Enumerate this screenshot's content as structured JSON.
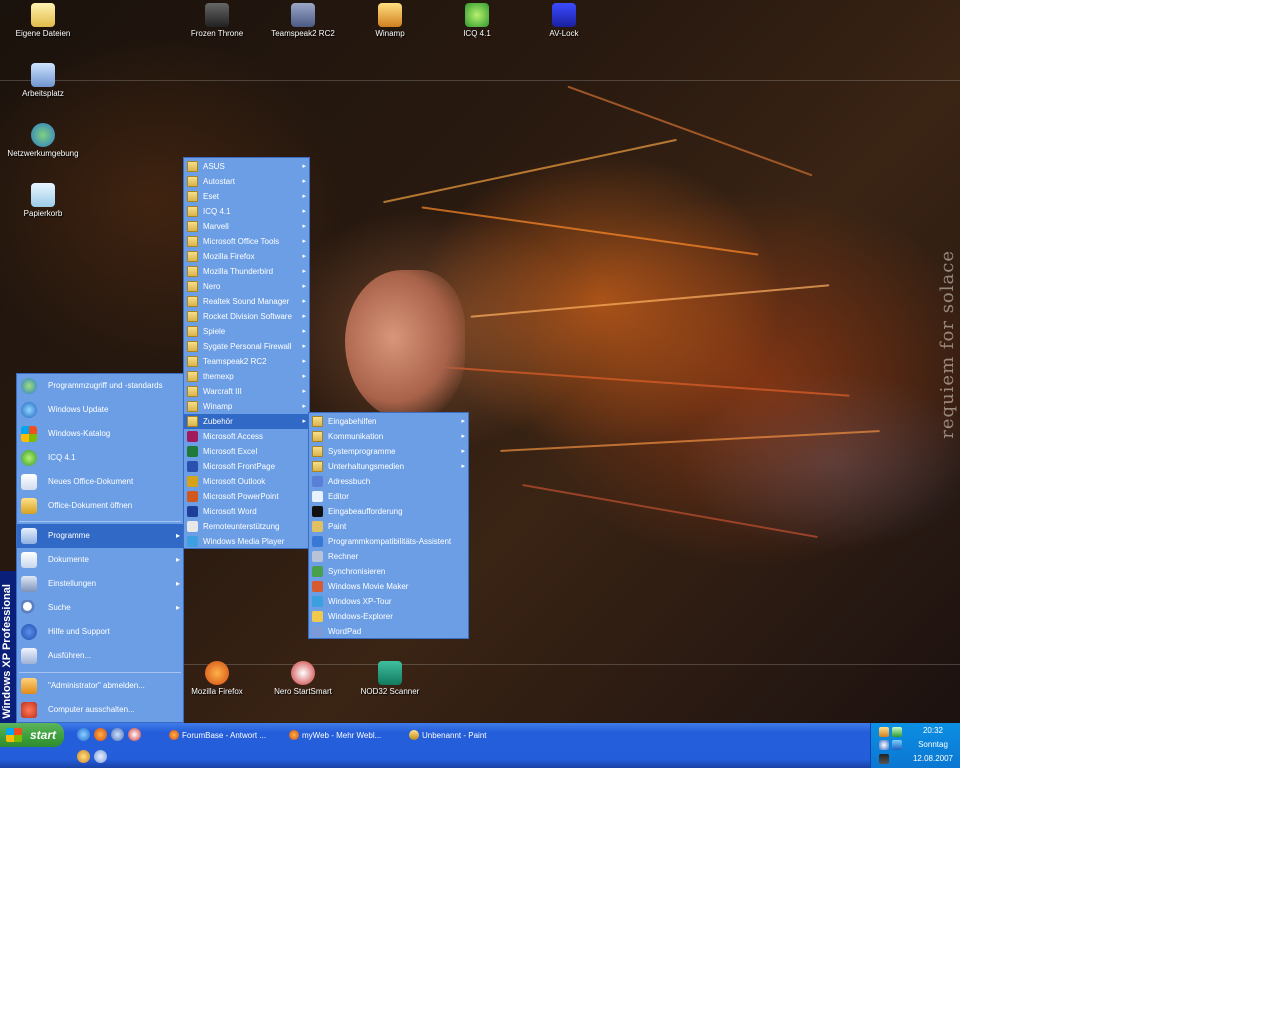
{
  "desktop": {
    "icons_left": [
      {
        "label": "Eigene Dateien",
        "icon": "documents-folder-icon"
      },
      {
        "label": "Arbeitsplatz",
        "icon": "my-computer-icon"
      },
      {
        "label": "Netzwerkumgebung",
        "icon": "network-places-icon"
      },
      {
        "label": "Papierkorb",
        "icon": "recycle-bin-icon"
      }
    ],
    "icons_top": [
      {
        "label": "Frozen Throne",
        "icon": "warcraft-icon"
      },
      {
        "label": "Teamspeak2 RC2",
        "icon": "teamspeak-icon"
      },
      {
        "label": "Winamp",
        "icon": "winamp-icon"
      },
      {
        "label": "ICQ 4.1",
        "icon": "icq-icon"
      },
      {
        "label": "AV-Lock",
        "icon": "av-lock-icon"
      }
    ],
    "icons_bottom": [
      {
        "label": "Mozilla Firefox",
        "icon": "firefox-icon"
      },
      {
        "label": "Nero StartSmart",
        "icon": "nero-icon"
      },
      {
        "label": "NOD32 Scanner",
        "icon": "nod32-icon"
      }
    ],
    "wallpaper_text": "requiem for solace"
  },
  "start_menu": {
    "band_text": "Windows XP Professional",
    "top_items": [
      {
        "label": "Programmzugriff und -standards",
        "icon": "program-defaults-icon"
      },
      {
        "label": "Windows Update",
        "icon": "windows-update-icon"
      },
      {
        "label": "Windows-Katalog",
        "icon": "windows-catalog-icon"
      },
      {
        "label": "ICQ 4.1",
        "icon": "icq-icon"
      },
      {
        "label": "Neues Office-Dokument",
        "icon": "new-office-doc-icon"
      },
      {
        "label": "Office-Dokument öffnen",
        "icon": "open-office-doc-icon"
      }
    ],
    "main_items": [
      {
        "label": "Programme",
        "icon": "programs-icon",
        "arrow": "▸",
        "highlight": true
      },
      {
        "label": "Dokumente",
        "icon": "documents-icon",
        "arrow": "▸"
      },
      {
        "label": "Einstellungen",
        "icon": "settings-icon",
        "arrow": "▸"
      },
      {
        "label": "Suche",
        "icon": "search-icon",
        "arrow": "▸"
      },
      {
        "label": "Hilfe und Support",
        "icon": "help-icon",
        "arrow": ""
      },
      {
        "label": "Ausführen...",
        "icon": "run-icon",
        "arrow": ""
      }
    ],
    "bottom_items": [
      {
        "label": "\"Administrator\" abmelden...",
        "icon": "logoff-icon"
      },
      {
        "label": "Computer ausschalten...",
        "icon": "shutdown-icon"
      }
    ]
  },
  "programs_menu": [
    {
      "label": "ASUS",
      "folder": true
    },
    {
      "label": "Autostart",
      "folder": true
    },
    {
      "label": "Eset",
      "folder": true
    },
    {
      "label": "ICQ 4.1",
      "folder": true
    },
    {
      "label": "Marvell",
      "folder": true
    },
    {
      "label": "Microsoft Office Tools",
      "folder": true
    },
    {
      "label": "Mozilla Firefox",
      "folder": true
    },
    {
      "label": "Mozilla Thunderbird",
      "folder": true
    },
    {
      "label": "Nero",
      "folder": true
    },
    {
      "label": "Realtek Sound Manager",
      "folder": true
    },
    {
      "label": "Rocket Division Software",
      "folder": true
    },
    {
      "label": "Spiele",
      "folder": true
    },
    {
      "label": "Sygate Personal Firewall",
      "folder": true
    },
    {
      "label": "Teamspeak2 RC2",
      "folder": true
    },
    {
      "label": "themexp",
      "folder": true
    },
    {
      "label": "Warcraft III",
      "folder": true
    },
    {
      "label": "Winamp",
      "folder": true
    },
    {
      "label": "Zubehör",
      "folder": true,
      "highlight": true
    },
    {
      "label": "Microsoft Access",
      "folder": false,
      "icon_color": "#a31a5c"
    },
    {
      "label": "Microsoft Excel",
      "folder": false,
      "icon_color": "#1f7a3a"
    },
    {
      "label": "Microsoft FrontPage",
      "folder": false,
      "icon_color": "#2a50b0"
    },
    {
      "label": "Microsoft Outlook",
      "folder": false,
      "icon_color": "#d6a21a"
    },
    {
      "label": "Microsoft PowerPoint",
      "folder": false,
      "icon_color": "#d2571c"
    },
    {
      "label": "Microsoft Word",
      "folder": false,
      "icon_color": "#1d3f9a"
    },
    {
      "label": "Remoteunterstützung",
      "folder": false,
      "icon_color": "#e8e8e8"
    },
    {
      "label": "Windows Media Player",
      "folder": false,
      "icon_color": "#3da0e0"
    }
  ],
  "zubehoer_menu": [
    {
      "label": "Eingabehilfen",
      "folder": true
    },
    {
      "label": "Kommunikation",
      "folder": true
    },
    {
      "label": "Systemprogramme",
      "folder": true
    },
    {
      "label": "Unterhaltungsmedien",
      "folder": true
    },
    {
      "label": "Adressbuch",
      "folder": false,
      "icon_color": "#5a7fd6"
    },
    {
      "label": "Editor",
      "folder": false,
      "icon_color": "#eaf2ff"
    },
    {
      "label": "Eingabeaufforderung",
      "folder": false,
      "icon_color": "#111111"
    },
    {
      "label": "Paint",
      "folder": false,
      "icon_color": "#e0c060"
    },
    {
      "label": "Programmkompatibilitäts-Assistent",
      "folder": false,
      "icon_color": "#3a78d8"
    },
    {
      "label": "Rechner",
      "folder": false,
      "icon_color": "#b9c3d8"
    },
    {
      "label": "Synchronisieren",
      "folder": false,
      "icon_color": "#4aa04a"
    },
    {
      "label": "Windows Movie Maker",
      "folder": false,
      "icon_color": "#d85a30"
    },
    {
      "label": "Windows XP-Tour",
      "folder": false,
      "icon_color": "#3aa0e0"
    },
    {
      "label": "Windows-Explorer",
      "folder": false,
      "icon_color": "#f2c94c"
    },
    {
      "label": "WordPad",
      "folder": false,
      "icon_color": "#7a9ad8"
    }
  ],
  "taskbar": {
    "start_label": "start",
    "quick_launch": [
      "ie-icon",
      "firefox-icon",
      "media-player-icon",
      "nero-icon",
      "winamp-icon",
      "desktop-icon"
    ],
    "tasks": [
      {
        "label": "ForumBase - Antwort ...",
        "icon": "firefox-icon"
      },
      {
        "label": "myWeb - Mehr Webl...",
        "icon": "firefox-icon"
      },
      {
        "label": "Unbenannt - Paint",
        "icon": "paint-icon"
      }
    ],
    "clock": {
      "time": "20:32",
      "day": "Sonntag",
      "date": "12.08.2007"
    }
  }
}
